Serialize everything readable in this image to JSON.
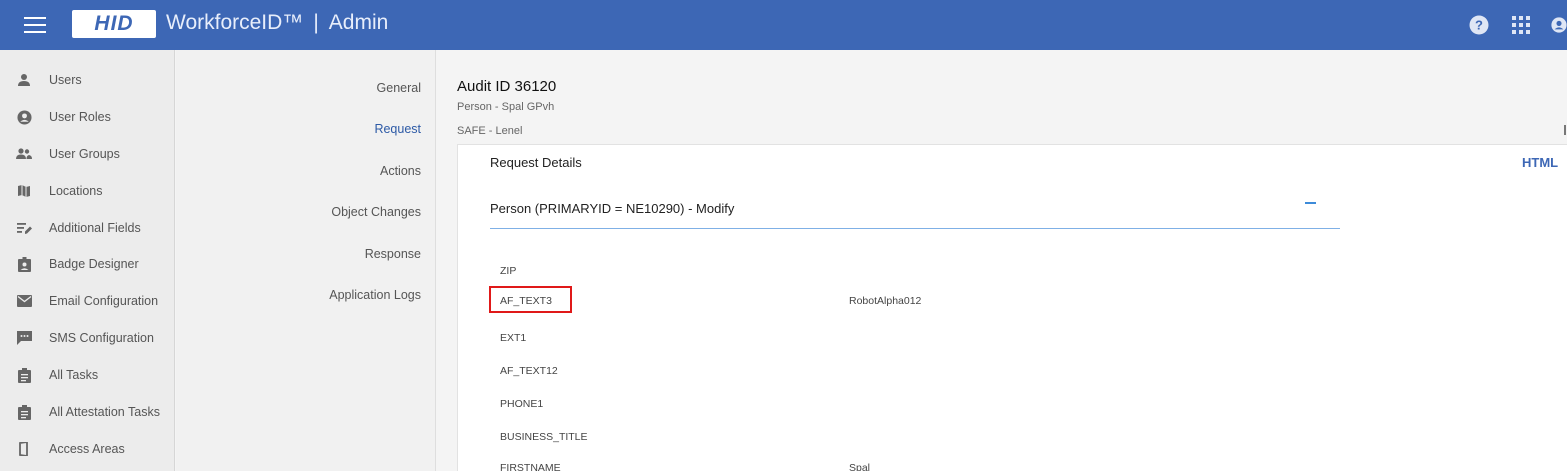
{
  "header": {
    "logo_text": "HID",
    "product_name": "WorkforceID™",
    "separator": "|",
    "section": "Admin",
    "bar_color": "#3d67b5",
    "icons": [
      "help-icon",
      "apps-grid-icon",
      "account-icon"
    ]
  },
  "sidebar": {
    "items": [
      {
        "label": "Users",
        "icon": "person-icon"
      },
      {
        "label": "User Roles",
        "icon": "account-circle-icon"
      },
      {
        "label": "User Groups",
        "icon": "group-icon"
      },
      {
        "label": "Locations",
        "icon": "map-icon"
      },
      {
        "label": "Additional Fields",
        "icon": "edit-note-icon"
      },
      {
        "label": "Badge Designer",
        "icon": "badge-icon"
      },
      {
        "label": "Email Configuration",
        "icon": "mail-icon"
      },
      {
        "label": "SMS Configuration",
        "icon": "sms-icon"
      },
      {
        "label": "All Tasks",
        "icon": "clipboard-icon"
      },
      {
        "label": "All Attestation Tasks",
        "icon": "clipboard-icon"
      },
      {
        "label": "Access Areas",
        "icon": "door-icon"
      }
    ]
  },
  "tabs": [
    {
      "label": "General",
      "active": false
    },
    {
      "label": "Request",
      "active": true
    },
    {
      "label": "Actions",
      "active": false
    },
    {
      "label": "Object Changes",
      "active": false
    },
    {
      "label": "Response",
      "active": false
    },
    {
      "label": "Application Logs",
      "active": false
    }
  ],
  "audit": {
    "title": "Audit ID 36120",
    "subtitle_person": "Person - Spal GPvh",
    "subtitle_system": "SAFE - Lenel"
  },
  "request": {
    "title": "Request Details",
    "html_link": "HTML",
    "section_title": "Person (PRIMARYID = NE10290) - Modify",
    "collapse_symbol": "−",
    "fields": [
      {
        "name": "ZIP",
        "value": ""
      },
      {
        "name": "AF_TEXT3",
        "value": "RobotAlpha012",
        "highlighted": true
      },
      {
        "name": "EXT1",
        "value": ""
      },
      {
        "name": "AF_TEXT12",
        "value": ""
      },
      {
        "name": "PHONE1",
        "value": ""
      },
      {
        "name": "BUSINESS_TITLE",
        "value": ""
      },
      {
        "name": "FIRSTNAME",
        "value": "Spal"
      }
    ]
  },
  "colors": {
    "accent": "#3d67b5",
    "active_tab": "#2d5aa6",
    "highlight": "#e01919",
    "divider": "#7fb0e6"
  }
}
